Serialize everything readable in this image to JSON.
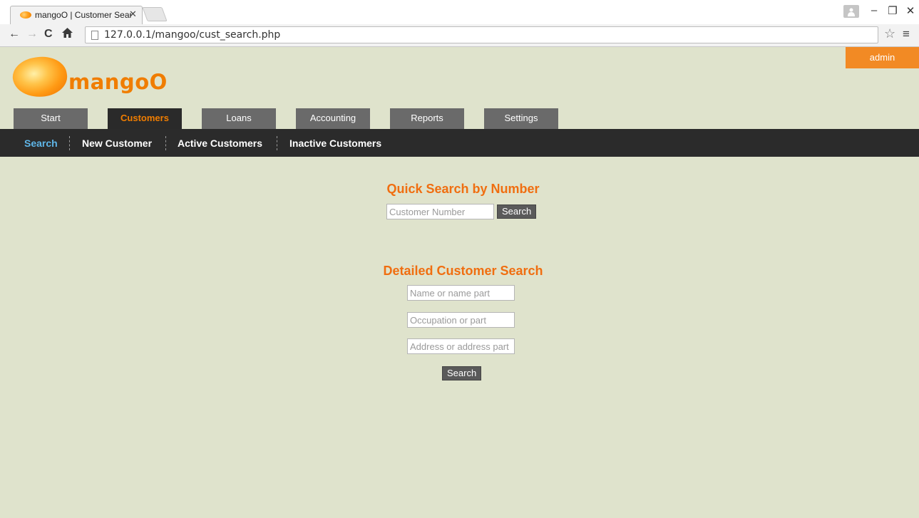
{
  "browser": {
    "tab_title": "mangoO | Customer Searc",
    "url": "127.0.0.1/mangoo/cust_search.php",
    "icons": {
      "back": "arrow-left-icon",
      "forward": "arrow-right-icon",
      "reload": "reload-icon",
      "home": "home-icon",
      "bookmark": "star-icon",
      "menu": "hamburger-menu-icon"
    }
  },
  "header": {
    "logo_text": "mangoO",
    "user_label": "admin"
  },
  "main_nav": [
    {
      "label": "Start"
    },
    {
      "label": "Customers",
      "active": true
    },
    {
      "label": "Loans"
    },
    {
      "label": "Accounting"
    },
    {
      "label": "Reports"
    },
    {
      "label": "Settings"
    }
  ],
  "sub_nav": [
    {
      "label": "Search",
      "active": true
    },
    {
      "label": "New Customer"
    },
    {
      "label": "Active Customers"
    },
    {
      "label": "Inactive Customers"
    }
  ],
  "quick_search": {
    "title": "Quick Search by Number",
    "placeholder": "Customer Number",
    "button": "Search"
  },
  "detailed_search": {
    "title": "Detailed Customer Search",
    "name_placeholder": "Name or name part",
    "occupation_placeholder": "Occupation or part",
    "address_placeholder": "Address or address part",
    "button": "Search"
  },
  "colors": {
    "accent": "#f07d00",
    "page_background": "#dfe3cc",
    "nav_dark": "#2b2b2b",
    "subnav_active": "#5fb6e8"
  }
}
